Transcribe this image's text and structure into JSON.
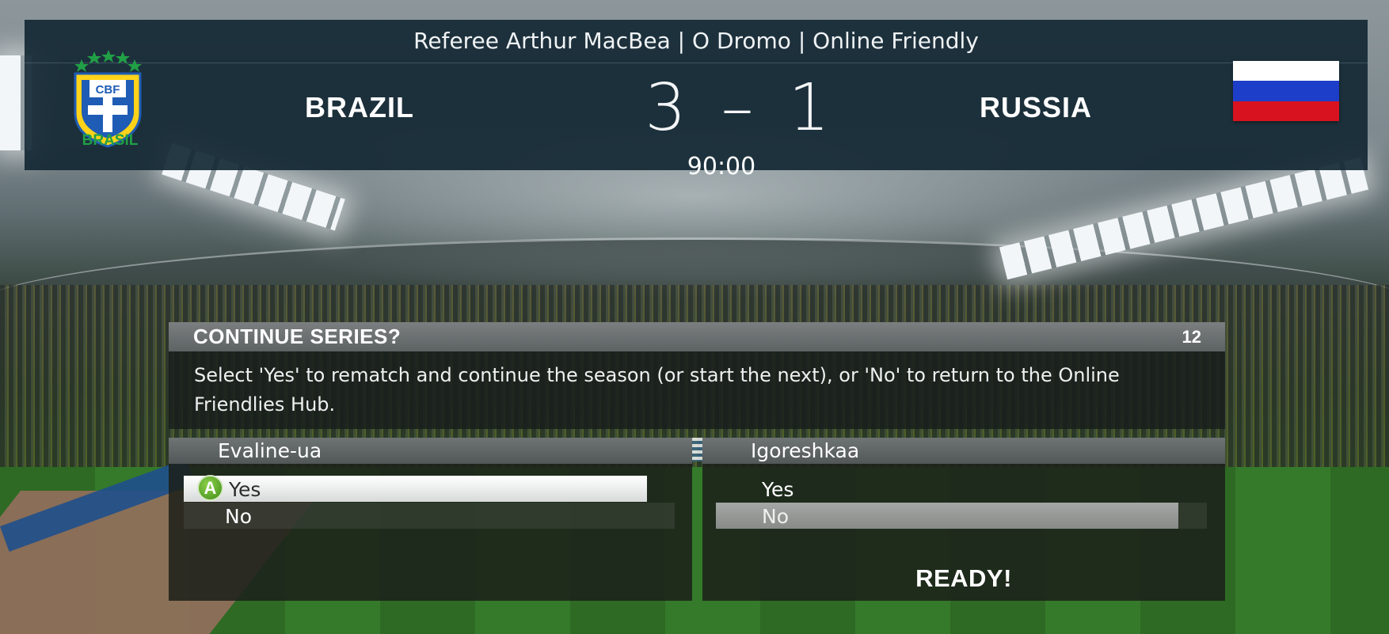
{
  "scoreboard": {
    "header": "Referee Arthur MacBea | O Dromo | Online Friendly",
    "home_team": "BRAZIL",
    "away_team": "RUSSIA",
    "home_score": "3",
    "score_separator": "–",
    "away_score": "1",
    "clock": "90:00",
    "home_crest_label": "BRASIL",
    "home_crest_text": "CBF"
  },
  "dialog": {
    "title": "CONTINUE SERIES?",
    "timer": "12",
    "message": "Select 'Yes' to rematch and continue the season (or start the next), or 'No' to return to the Online Friendlies Hub."
  },
  "players": {
    "left": {
      "name": "Evaline-ua",
      "options": [
        "Yes",
        "No"
      ],
      "selected": "Yes",
      "button_glyph": "A"
    },
    "right": {
      "name": "Igoreshkaa",
      "options": [
        "Yes",
        "No"
      ],
      "selected": "No",
      "status": "READY!"
    }
  },
  "colors": {
    "scoreboard_bg": "#142834",
    "brasil_green": "#21a046",
    "a_button_green": "#5aa82a",
    "russia_flag": [
      "#ffffff",
      "#1c3ec8",
      "#d8121f"
    ]
  }
}
